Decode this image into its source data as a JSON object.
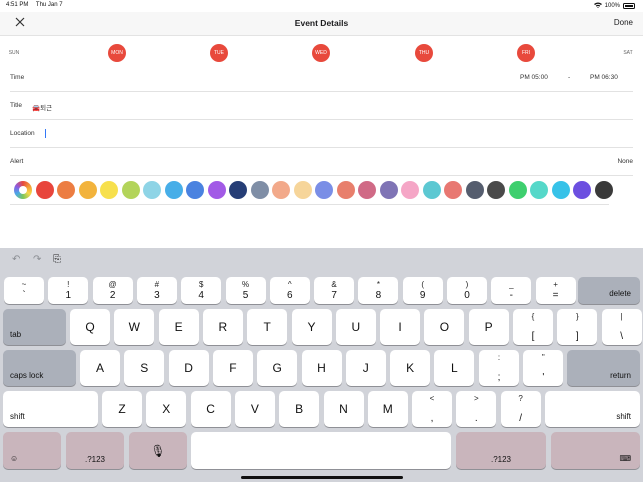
{
  "status": {
    "time": "4:51 PM",
    "date": "Thu Jan 7",
    "battery": "100%"
  },
  "nav": {
    "title": "Event Details",
    "done": "Done"
  },
  "weekdays": [
    {
      "label": "SUN",
      "selected": false
    },
    {
      "label": "MON",
      "selected": true
    },
    {
      "label": "TUE",
      "selected": true
    },
    {
      "label": "WED",
      "selected": true
    },
    {
      "label": "THU",
      "selected": true
    },
    {
      "label": "FRI",
      "selected": true
    },
    {
      "label": "SAT",
      "selected": false
    }
  ],
  "form": {
    "time_label": "Time",
    "time_start": "PM 05:00",
    "time_dash": "-",
    "time_end": "PM 06:30",
    "title_label": "Title",
    "title_value": "🚘퇴근",
    "location_label": "Location",
    "location_value": "",
    "alert_label": "Alert",
    "alert_value": "None"
  },
  "palette": [
    "rainbow",
    "#e8453c",
    "#ec7d42",
    "#f2b33c",
    "#f7e04d",
    "#b3d45a",
    "#8ed4e6",
    "#47aee8",
    "#4a82e0",
    "#a25ae6",
    "#263e76",
    "#7f8ea6",
    "#f2a98a",
    "#f6d59a",
    "#7a8ee6",
    "#e87f6c",
    "#d06a86",
    "#7f74b5",
    "#f5a6c6",
    "#5cc8d2",
    "#e87872",
    "#555d6e",
    "#4a4a4a",
    "#3ecf6e",
    "#55d8c9",
    "#37c2e8",
    "#6c4fe0",
    "#3a3a3a"
  ],
  "keyboard": {
    "tools": {
      "undo": "↶",
      "redo": "↷",
      "paste": "⎘"
    },
    "row1": [
      {
        "up": "~",
        "dn": "`"
      },
      {
        "up": "!",
        "dn": "1"
      },
      {
        "up": "@",
        "dn": "2"
      },
      {
        "up": "#",
        "dn": "3"
      },
      {
        "up": "$",
        "dn": "4"
      },
      {
        "up": "%",
        "dn": "5"
      },
      {
        "up": "^",
        "dn": "6"
      },
      {
        "up": "&",
        "dn": "7"
      },
      {
        "up": "*",
        "dn": "8"
      },
      {
        "up": "(",
        "dn": "9"
      },
      {
        "up": ")",
        "dn": "0"
      },
      {
        "up": "_",
        "dn": "-"
      },
      {
        "up": "+",
        "dn": "="
      }
    ],
    "delete": "delete",
    "tab": "tab",
    "row2": [
      "Q",
      "W",
      "E",
      "R",
      "T",
      "Y",
      "U",
      "I",
      "O",
      "P"
    ],
    "row2_extra": [
      {
        "up": "{",
        "dn": "["
      },
      {
        "up": "}",
        "dn": "]"
      },
      {
        "up": "|",
        "dn": "\\"
      }
    ],
    "caps": "caps lock",
    "row3": [
      "A",
      "S",
      "D",
      "F",
      "G",
      "H",
      "J",
      "K",
      "L"
    ],
    "row3_extra": [
      {
        "up": ":",
        "dn": ";"
      },
      {
        "up": "\"",
        "dn": "'"
      }
    ],
    "return": "return",
    "shift": "shift",
    "row4": [
      "Z",
      "X",
      "C",
      "V",
      "B",
      "N",
      "M"
    ],
    "row4_extra": [
      {
        "up": "<",
        "dn": ","
      },
      {
        "up": ">",
        "dn": "."
      },
      {
        "up": "?",
        "dn": "/"
      }
    ],
    "shift_right": "shift",
    "emoji": "☺",
    "num_left": ".?123",
    "mic": "🎙",
    "space": "",
    "num_right": ".?123",
    "hide": "⌨"
  }
}
